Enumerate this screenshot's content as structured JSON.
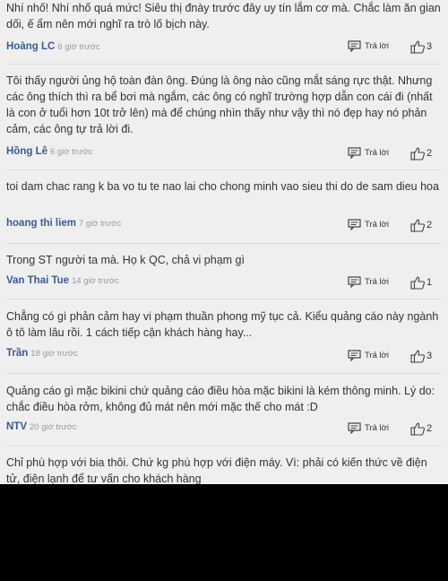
{
  "ui": {
    "reply_label": "Trả lời"
  },
  "comments": [
    {
      "text": "Nhí nhố! Nhí nhố quá mức! Siêu thị đnày trước đây uy tín lắm cơ mà. Chắc làm ăn gian dối, ế ẩm nên mới nghĩ ra trò lố bịch này.",
      "author": "Hoàng LC",
      "time": "6 giờ trước",
      "likes": "3"
    },
    {
      "text": "Tôi thấy người ủng hộ toàn đàn ông. Đúng là ông nào cũng mắt sáng rực thật. Nhưng các ông thích thì ra bể bơi mà ngắm, các ông có nghĩ trường hợp dẫn con cái đi (nhất là con ở tuổi hơn 10t trở lên) mà để chúng nhìn thấy như vậy thì nó đẹp hay nó phản cảm, các ông tự trả lời đi.",
      "author": "Hồng Lê",
      "time": "6 giờ trước",
      "likes": "2"
    },
    {
      "text": "toi dam chac rang k ba vo tu te nao lai cho chong minh vao sieu thi do de sam dieu hoa",
      "author": "hoang thi liem",
      "time": "7 giờ trước",
      "likes": "2"
    },
    {
      "text": "Trong ST người ta mà. Họ k QC, chả vi phạm gì",
      "author": "Van Thai Tue",
      "time": "14 giờ trước",
      "likes": "1"
    },
    {
      "text": "Chẳng có gì phản cảm hay vi phạm thuần phong mỹ tục cả. Kiểu quảng cáo này ngành ô tô làm lâu rồi. 1 cách tiếp cận khách hàng hay...",
      "author": "Trần",
      "time": "18 giờ trước",
      "likes": "3"
    },
    {
      "text": "Quảng cáo gì mặc bikini chứ quảng cáo điều hòa mặc bikini là kém thông minh. Lý do: chắc điều hòa rởm, không đủ mát nên mới mặc thế cho mát :D",
      "author": "NTV",
      "time": "20 giờ trước",
      "likes": "2"
    },
    {
      "text": "Chỉ phù hợp với bia thôi. Chứ kg phù hợp với điện máy. Vì: phải có kiến thức về điện tử, điện lạnh để tư vấn cho khách hàng",
      "author": "",
      "time": "",
      "likes": ""
    }
  ]
}
